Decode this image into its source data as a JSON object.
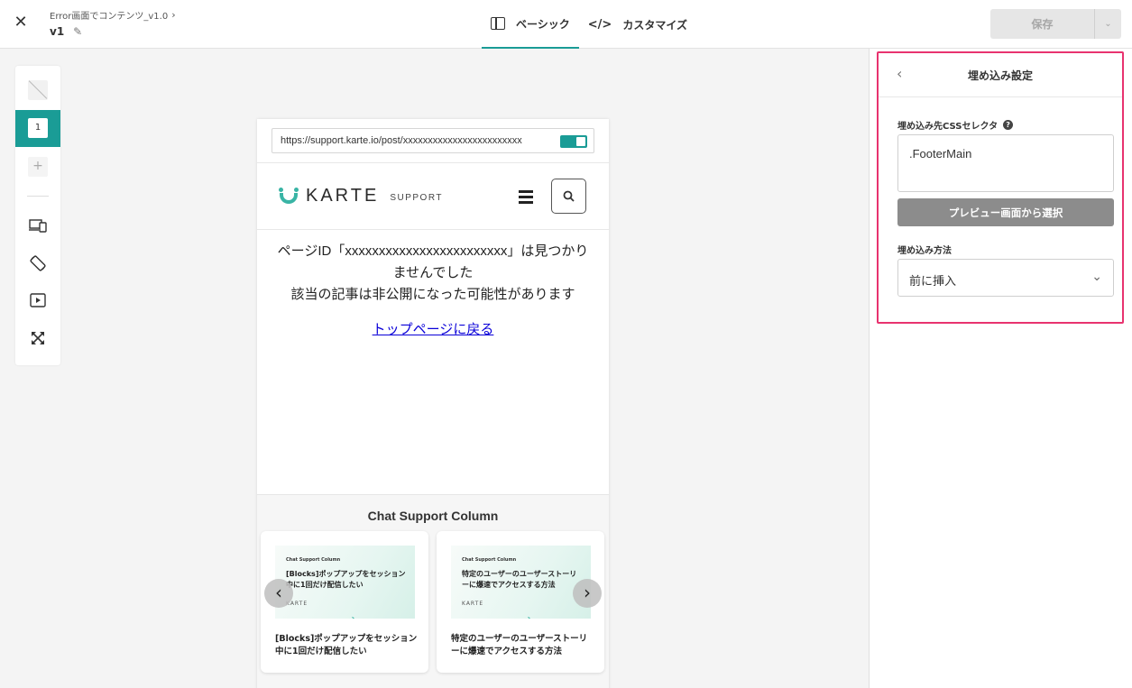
{
  "header": {
    "close_icon": "close-icon",
    "breadcrumb": "Error画面でコンテンツ_v1.0",
    "version": "v1",
    "tabs": [
      {
        "label": "ベーシック",
        "icon": "layout-icon",
        "active": true
      },
      {
        "label": "カスタマイズ",
        "icon": "code-icon",
        "active": false
      }
    ],
    "save_label": "保存"
  },
  "toolstrip": {
    "step_number": "1",
    "add_symbol": "+"
  },
  "preview": {
    "url": "https://support.karte.io/post/xxxxxxxxxxxxxxxxxxxxxxxx",
    "logo_text": "KARTE",
    "logo_sub": "SUPPORT",
    "message_line1": "ページID「xxxxxxxxxxxxxxxxxxxxxxxx」は見つかりませんでした",
    "message_line2": "該当の記事は非公開になった可能性があります",
    "top_link": "トップページに戻る",
    "column_title": "Chat Support Column",
    "cards": [
      {
        "thumb_tag": "Chat Support Column",
        "thumb_title": "[Blocks]ポップアップをセッション中に1回だけ配信したい",
        "thumb_logo": "KARTE",
        "caption": "[Blocks]ポップアップをセッション中に1回だけ配信したい"
      },
      {
        "thumb_tag": "Chat Support Column",
        "thumb_title": "特定のユーザーのユーザーストーリーに爆速でアクセスする方法",
        "thumb_logo": "KARTE",
        "caption": "特定のユーザーのユーザーストーリーに爆速でアクセスする方法"
      }
    ]
  },
  "panel": {
    "title": "埋め込み設定",
    "selector_label": "埋め込み先CSSセレクタ",
    "selector_value": ".FooterMain",
    "pick_button": "プレビュー画面から選択",
    "method_label": "埋め込み方法",
    "method_value": "前に挿入"
  },
  "colors": {
    "accent": "#1a9c96",
    "highlight": "#e8336f",
    "link": "#0a00d8"
  }
}
